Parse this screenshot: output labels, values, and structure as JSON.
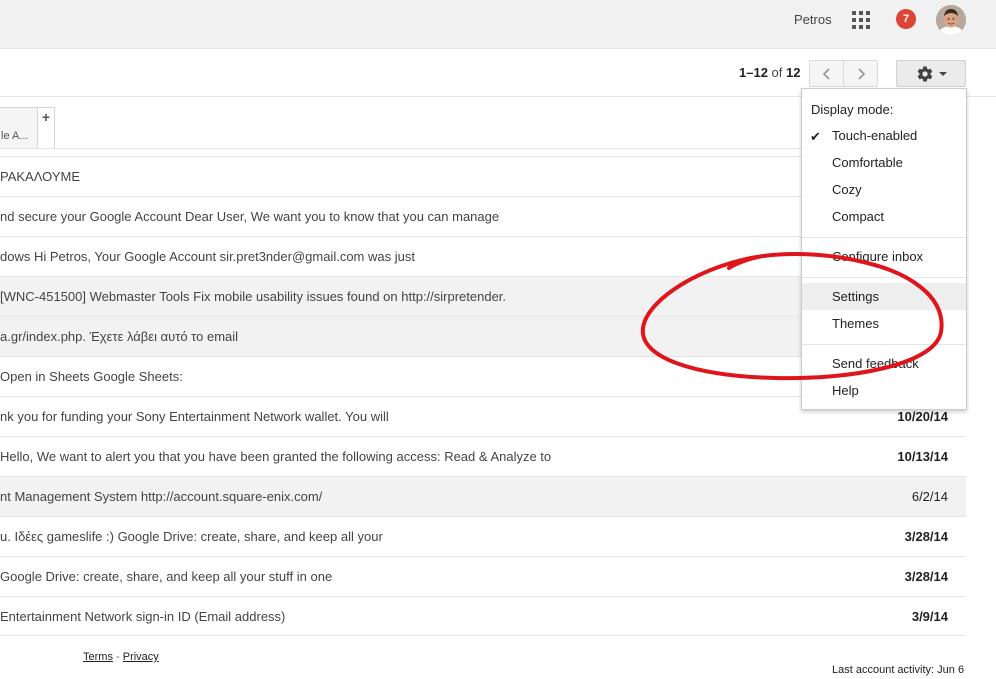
{
  "header": {
    "username": "Petros",
    "notification_count": "7"
  },
  "toolbar": {
    "pager_range": "1–12",
    "pager_of": " of ",
    "pager_total": "12"
  },
  "tabs": {
    "partial_label": "le A...",
    "add_label": "+"
  },
  "emails": [
    {
      "snippet": "ΡΑΚΑΛΟΥΜΕ",
      "date": "",
      "bold": false,
      "read": false
    },
    {
      "snippet": "nd secure your Google Account Dear User, We want you to know that you can manage",
      "date": "",
      "bold": false,
      "read": false
    },
    {
      "snippet": "dows Hi Petros, Your Google Account sir.pret3nder@gmail.com was just",
      "date": "",
      "bold": false,
      "read": false
    },
    {
      "snippet": "[WNC-451500] Webmaster Tools Fix mobile usability issues found on http://sirpretender.",
      "date": "",
      "bold": false,
      "read": true
    },
    {
      "snippet": "a.gr/index.php. Έχετε λάβει αυτό το email",
      "date": "",
      "bold": false,
      "read": true
    },
    {
      "snippet": "Open in Sheets Google Sheets:",
      "date": "",
      "bold": false,
      "read": false
    },
    {
      "snippet": "nk you for funding your Sony Entertainment Network wallet. You will",
      "date": "10/20/14",
      "bold": true,
      "read": false
    },
    {
      "snippet": "Hello, We want to alert you that you have been granted the following access: Read & Analyze to",
      "date": "10/13/14",
      "bold": true,
      "read": false
    },
    {
      "snippet": "nt Management System http://account.square-enix.com/",
      "date": "6/2/14",
      "bold": false,
      "read": true
    },
    {
      "snippet": "u. Ιδέες gameslife :) Google Drive: create, share, and keep all your",
      "date": "3/28/14",
      "bold": true,
      "read": false
    },
    {
      "snippet": "Google Drive: create, share, and keep all your stuff in one",
      "date": "3/28/14",
      "bold": true,
      "read": false
    },
    {
      "snippet": "Entertainment Network sign-in ID (Email address)",
      "date": "3/9/14",
      "bold": true,
      "read": false
    }
  ],
  "footer": {
    "terms": "Terms",
    "separator": " - ",
    "privacy": "Privacy",
    "activity": "Last account activity: Jun 6"
  },
  "menu": {
    "heading": "Display mode:",
    "check_glyph": "✔",
    "items": [
      {
        "label": "Touch-enabled",
        "checked": true
      },
      {
        "label": "Comfortable"
      },
      {
        "label": "Cozy"
      },
      {
        "label": "Compact"
      },
      {
        "label": "Configure inbox"
      },
      {
        "label": "Settings"
      },
      {
        "label": "Themes"
      },
      {
        "label": "Send feedback"
      },
      {
        "label": "Help"
      }
    ]
  },
  "colors": {
    "annotation": "#e0151b",
    "badge": "#db4437"
  }
}
